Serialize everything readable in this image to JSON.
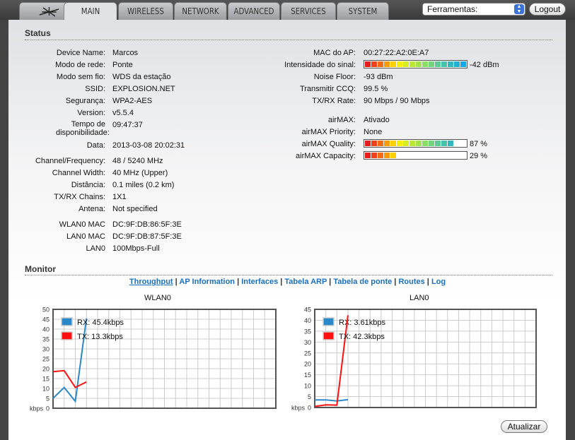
{
  "nav": {
    "tabs": [
      "MAIN",
      "WIRELESS",
      "NETWORK",
      "ADVANCED",
      "SERVICES",
      "SYSTEM"
    ],
    "active": "MAIN",
    "tools_select": "Ferramentas:",
    "logout": "Logout"
  },
  "status": {
    "title": "Status",
    "left": [
      [
        "Device Name:",
        "Marcos"
      ],
      [
        "Modo de rede:",
        "Ponte"
      ],
      [
        "Modo sem fio:",
        "WDS da estação"
      ],
      [
        "SSID:",
        "EXPLOSION.NET"
      ],
      [
        "Segurança:",
        "WPA2-AES"
      ],
      [
        "Version:",
        "v5.5.4"
      ],
      [
        "Tempo de disponibilidade:",
        "09:47:37"
      ],
      [
        "Data:",
        "2013-03-08 20:02:31"
      ],
      [
        "Channel/Frequency:",
        "48 / 5240 MHz"
      ],
      [
        "Channel Width:",
        "40 MHz (Upper)"
      ],
      [
        "Distância:",
        "0.1 miles (0.2 km)"
      ],
      [
        "TX/RX Chains:",
        "1X1"
      ],
      [
        "Antena:",
        "Not specified"
      ],
      [
        "WLAN0 MAC",
        "DC:9F:DB:86:5F:3E"
      ],
      [
        "LAN0 MAC",
        "DC:9F:DB:87:5F:3E"
      ],
      [
        "LAN0",
        "100Mbps-Full"
      ]
    ],
    "right": [
      [
        "MAC do AP:",
        "00:27:22:A2:0E:A7"
      ],
      [
        "Intensidade do sinal:",
        "-42 dBm"
      ],
      [
        "Noise Floor:",
        "-93 dBm"
      ],
      [
        "Transmitir CCQ:",
        "99.5 %"
      ],
      [
        "TX/RX Rate:",
        "90 Mbps / 90 Mbps"
      ],
      [
        "airMAX:",
        "Ativado"
      ],
      [
        "airMAX Priority:",
        "None"
      ],
      [
        "airMAX Quality:",
        "87 %"
      ],
      [
        "airMAX Capacity:",
        "29 %"
      ]
    ],
    "signal_fraction": 1.0,
    "quality_percent": 87,
    "capacity_percent": 29
  },
  "monitor": {
    "title": "Monitor",
    "links": [
      "Throughput",
      "AP Information",
      "Interfaces",
      "Tabela ARP",
      "Tabela de ponte",
      "Routes",
      "Log"
    ],
    "active_link": "Throughput",
    "refresh": "Atualizar"
  },
  "chart_data": [
    {
      "type": "line",
      "title": "WLAN0",
      "ylabel": "kbps",
      "ylim": [
        0,
        50
      ],
      "yticks": [
        0,
        5,
        10,
        15,
        20,
        25,
        30,
        35,
        40,
        45,
        50
      ],
      "x": [
        0,
        1,
        2,
        3
      ],
      "series": [
        {
          "name": "RX",
          "legend": "RX: 45.4kbps",
          "color": "#2a88c8",
          "values": [
            5,
            10.5,
            3.5,
            45.4
          ]
        },
        {
          "name": "TX",
          "legend": "TX: 13.3kbps",
          "color": "#ff1010",
          "values": [
            18.5,
            19,
            10.5,
            13.3
          ]
        }
      ]
    },
    {
      "type": "line",
      "title": "LAN0",
      "ylabel": "kbps",
      "ylim": [
        0,
        45
      ],
      "yticks": [
        0,
        5,
        10,
        15,
        20,
        25,
        30,
        35,
        40,
        45
      ],
      "x": [
        0,
        1,
        2,
        3
      ],
      "series": [
        {
          "name": "RX",
          "legend": "RX: 3.61kbps",
          "color": "#2a88c8",
          "values": [
            3.5,
            3.5,
            3,
            3.61
          ]
        },
        {
          "name": "TX",
          "legend": "TX: 42.3kbps",
          "color": "#ff1010",
          "values": [
            0.5,
            1.2,
            1.1,
            42.3
          ]
        }
      ]
    }
  ]
}
